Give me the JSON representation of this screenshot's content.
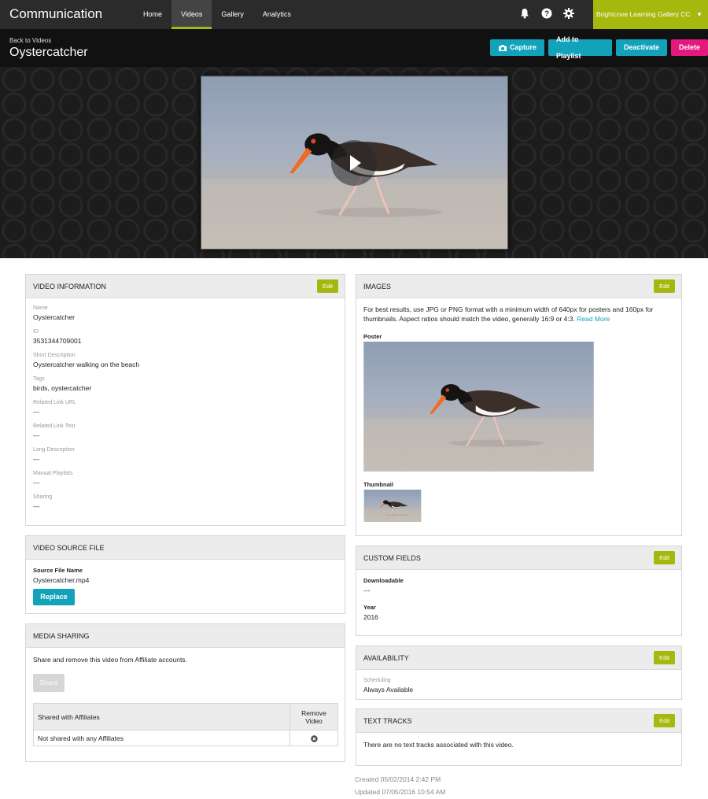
{
  "app": {
    "brand": "Communication",
    "nav": [
      "Home",
      "Videos",
      "Gallery",
      "Analytics"
    ],
    "active_nav": "Videos",
    "account": "Brightcove Learning Gallery CC",
    "icons": [
      "bell-icon",
      "help-icon",
      "gear-icon"
    ]
  },
  "header": {
    "back": "Back to Videos",
    "title": "Oystercatcher",
    "buttons": {
      "capture": "Capture",
      "add_playlist": "Add to Playlist",
      "deactivate": "Deactivate",
      "delete": "Delete"
    }
  },
  "video_info": {
    "title": "VIDEO INFORMATION",
    "edit": "Edit",
    "fields": [
      {
        "label": "Name",
        "value": "Oystercatcher"
      },
      {
        "label": "ID",
        "value": "3531344709001"
      },
      {
        "label": "Short Description",
        "value": "Oystercatcher walking on the beach"
      },
      {
        "label": "Tags",
        "value": "birds, oystercatcher"
      },
      {
        "label": "Related Link URL",
        "value": "---"
      },
      {
        "label": "Related Link Text",
        "value": "---"
      },
      {
        "label": "Long Description",
        "value": "---"
      },
      {
        "label": "Manual Playlists",
        "value": "---"
      },
      {
        "label": "Sharing",
        "value": "---"
      }
    ]
  },
  "source_file": {
    "title": "VIDEO SOURCE FILE",
    "label": "Source File Name",
    "value": "Oystercatcher.mp4",
    "replace": "Replace"
  },
  "media_sharing": {
    "title": "MEDIA SHARING",
    "text": "Share and remove this video from Affiliate accounts.",
    "share": "Share",
    "col1": "Shared with Affiliates",
    "col2a": "Remove",
    "col2b": "Video",
    "row": "Not shared with any Affiliates"
  },
  "images": {
    "title": "IMAGES",
    "edit": "Edit",
    "text": "For best results, use JPG or PNG format with a minimum width of 640px for posters and 160px for thumbnails. Aspect ratios should match the video, generally 16:9 or 4:3.",
    "read_more": "Read More",
    "poster": "Poster",
    "thumbnail": "Thumbnail"
  },
  "custom_fields": {
    "title": "CUSTOM FIELDS",
    "edit": "Edit",
    "downloadable_label": "Downloadable",
    "downloadable_value": "---",
    "year_label": "Year",
    "year_value": "2016"
  },
  "availability": {
    "title": "AVAILABILITY",
    "edit": "Edit",
    "label": "Scheduling",
    "value": "Always Available"
  },
  "text_tracks": {
    "title": "TEXT TRACKS",
    "edit": "Edit",
    "text": "There are no text tracks associated with this video."
  },
  "footer": {
    "created": "Created 05/02/2014 2:42 PM",
    "updated": "Updated 07/05/2016 10:54 AM"
  },
  "colors": {
    "accent_green": "#a5b80d",
    "teal": "#12a3ba",
    "pink": "#e5187e"
  }
}
